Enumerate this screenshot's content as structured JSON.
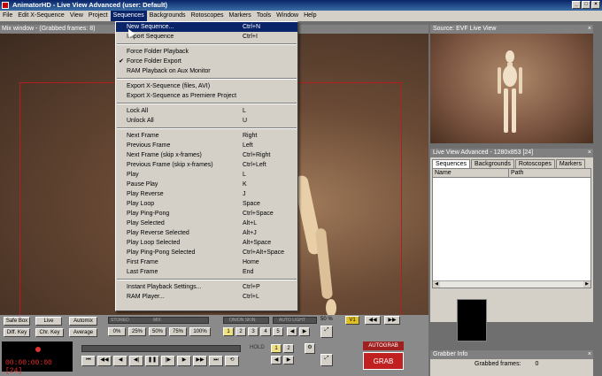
{
  "window": {
    "title": "AnimatorHD - Live View Advanced  (user: Default)",
    "controls": [
      "_",
      "□",
      "×"
    ]
  },
  "menubar": [
    "File",
    "Edit X-Sequence",
    "View",
    "Project",
    "Sequences",
    "Backgrounds",
    "Rotoscopes",
    "Markers",
    "Tools",
    "Window",
    "Help"
  ],
  "mix_window": {
    "title": "Mix window - (Grabbed frames: 8)"
  },
  "sequences_menu": {
    "items": [
      {
        "label": "New Sequence...",
        "shortcut": "Ctrl+N",
        "highlighted": true
      },
      {
        "label": "Import Sequence",
        "shortcut": "Ctrl+I"
      },
      {
        "sep": true
      },
      {
        "label": "Force Folder Playback",
        "shortcut": ""
      },
      {
        "label": "Force Folder Export",
        "shortcut": "",
        "checked": true
      },
      {
        "label": "RAM Playback on Aux Monitor",
        "shortcut": ""
      },
      {
        "sep": true
      },
      {
        "label": "Export X-Sequence  (files, AVI)",
        "shortcut": ""
      },
      {
        "label": "Export X-Sequence as Premiere Project",
        "shortcut": ""
      },
      {
        "sep": true
      },
      {
        "label": "Lock All",
        "shortcut": "L"
      },
      {
        "label": "Unlock All",
        "shortcut": "U"
      },
      {
        "sep": true
      },
      {
        "label": "Next Frame",
        "shortcut": "Right"
      },
      {
        "label": "Previous Frame",
        "shortcut": "Left"
      },
      {
        "label": "Next Frame (skip x-frames)",
        "shortcut": "Ctrl+Right"
      },
      {
        "label": "Previous Frame (skip x-frames)",
        "shortcut": "Ctrl+Left"
      },
      {
        "label": "Play",
        "shortcut": "L"
      },
      {
        "label": "Pause Play",
        "shortcut": "K"
      },
      {
        "label": "Play Reverse",
        "shortcut": "J"
      },
      {
        "label": "Play Loop",
        "shortcut": "Space"
      },
      {
        "label": "Play Ping-Pong",
        "shortcut": "Ctrl+Space"
      },
      {
        "label": "Play Selected",
        "shortcut": "Alt+L"
      },
      {
        "label": "Play Reverse Selected",
        "shortcut": "Alt+J"
      },
      {
        "label": "Play Loop Selected",
        "shortcut": "Alt+Space"
      },
      {
        "label": "Play Ping-Pong Selected",
        "shortcut": "Ctrl+Alt+Space"
      },
      {
        "label": "First Frame",
        "shortcut": "Home"
      },
      {
        "label": "Last Frame",
        "shortcut": "End"
      },
      {
        "sep": true
      },
      {
        "label": "Instant Playback Settings...",
        "shortcut": "Ctrl+P"
      },
      {
        "label": "RAM Player...",
        "shortcut": "Ctrl+L"
      }
    ]
  },
  "source_window": {
    "title": "Source: EVF Live View"
  },
  "live_view_advanced": {
    "title": "Live View Advanced - 1280x853 [24]",
    "tabs": [
      "Sequences",
      "Backgrounds",
      "Rotoscopes",
      "Markers"
    ],
    "columns": [
      "Name",
      "Path"
    ]
  },
  "grabber_info": {
    "title": "Grabber Info",
    "label": "Grabbed frames:",
    "value": "0"
  },
  "controls": {
    "safe_box": "Safe Box",
    "live": "Live",
    "automix": "Automix",
    "diff_key": "Diff. Key",
    "chr_key": "Chr. Key",
    "average": "Average",
    "zoom_buttons": [
      "0%",
      "25%",
      "50%",
      "75%",
      "100%"
    ],
    "stored_label": "STORED",
    "mix_label": "MIX",
    "percent": "50 %",
    "v_label": "V1",
    "onion_label": "ONION SKIN",
    "auto_light": "AUTO LIGHT",
    "onion_buttons": [
      "1",
      "2",
      "3",
      "4",
      "5"
    ],
    "hold_label": "HOLD",
    "hold_buttons": [
      "1",
      "2"
    ],
    "timecode": "00:00:00:00 [24]",
    "autograb": "AUTOGRAB",
    "grab": "GRAB"
  }
}
